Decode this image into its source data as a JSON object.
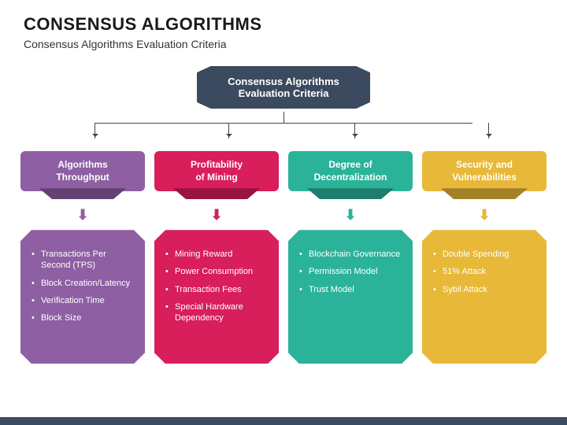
{
  "header": {
    "title": "CONSENSUS ALGORITHMS",
    "subtitle": "Consensus Algorithms Evaluation Criteria"
  },
  "root": {
    "line1": "Consensus Algorithms",
    "line2": "Evaluation Criteria"
  },
  "cols": [
    {
      "label1": "Algorithms",
      "label2": "Throughput",
      "items": [
        "Transactions Per Second (TPS)",
        "Block Creation/Latency",
        "Verification Time",
        "Block Size"
      ]
    },
    {
      "label1": "Profitability",
      "label2": "of Mining",
      "items": [
        "Mining Reward",
        "Power Consumption",
        "Transaction Fees",
        "Special Hardware Dependency"
      ]
    },
    {
      "label1": "Degree of",
      "label2": "Decentralization",
      "items": [
        "Blockchain Governance",
        "Permission Model",
        "Trust Model"
      ]
    },
    {
      "label1": "Security and",
      "label2": "Vulnerabilities",
      "items": [
        "Double Spending",
        "51% Attack",
        "Sybil Attack"
      ]
    }
  ]
}
